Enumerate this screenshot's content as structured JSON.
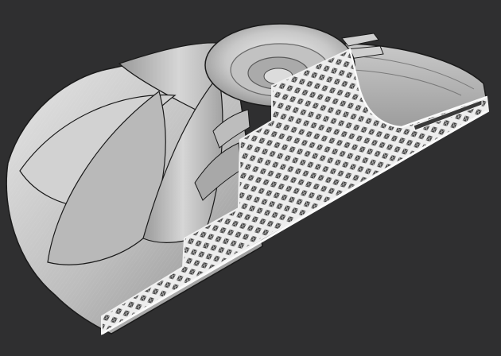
{
  "viewport": {
    "background": "#2f2f30",
    "model": "impeller-cross-section-lattice"
  },
  "colors": {
    "shade_light": "#d9d9d9",
    "shade_mid": "#b4b4b4",
    "shade_dark": "#6e6e6e",
    "lattice_line": "#f2f2f2",
    "lattice_hole": "#3a3a3a",
    "outline": "#1a1a1a"
  }
}
